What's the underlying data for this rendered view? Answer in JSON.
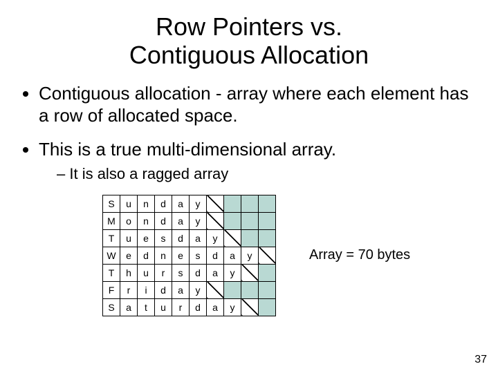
{
  "title_line1": "Row Pointers vs.",
  "title_line2": "Contiguous Allocation",
  "bullets": {
    "b1": "Contiguous allocation - array where each element has a row of allocated space.",
    "b2": "This is a true multi-dimensional array.",
    "b2_sub": "It is also a ragged array"
  },
  "table": {
    "cols": 10,
    "rows": [
      [
        "S",
        "u",
        "n",
        "d",
        "a",
        "y"
      ],
      [
        "M",
        "o",
        "n",
        "d",
        "a",
        "y"
      ],
      [
        "T",
        "u",
        "e",
        "s",
        "d",
        "a",
        "y"
      ],
      [
        "W",
        "e",
        "d",
        "n",
        "e",
        "s",
        "d",
        "a",
        "y"
      ],
      [
        "T",
        "h",
        "u",
        "r",
        "s",
        "d",
        "a",
        "y"
      ],
      [
        "F",
        "r",
        "i",
        "d",
        "a",
        "y"
      ],
      [
        "S",
        "a",
        "t",
        "u",
        "r",
        "d",
        "a",
        "y"
      ]
    ]
  },
  "caption": "Array = 70 bytes",
  "page_number": "37"
}
